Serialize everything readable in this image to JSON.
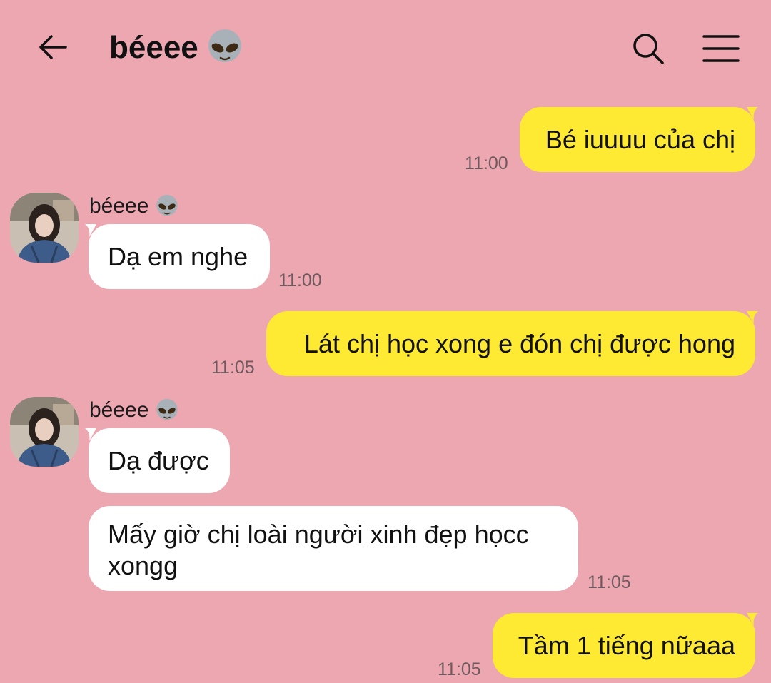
{
  "header": {
    "title": "béeee",
    "title_emoji": "alien-face-icon",
    "back_icon": "back-arrow-icon",
    "search_icon": "search-icon",
    "menu_icon": "menu-icon"
  },
  "colors": {
    "background": "#eda7b1",
    "outgoing_bubble": "#fee933",
    "incoming_bubble": "#ffffff"
  },
  "messages": [
    {
      "direction": "outgoing",
      "text": "Bé iuuuu của chị",
      "time": "11:00"
    },
    {
      "direction": "incoming",
      "sender": "béeee",
      "text": "Dạ em nghe",
      "time": "11:00"
    },
    {
      "direction": "outgoing",
      "text": "Lát chị học xong e đón chị được hong",
      "time": "11:05"
    },
    {
      "direction": "incoming",
      "sender": "béeee",
      "text": "Dạ được",
      "time": ""
    },
    {
      "direction": "incoming",
      "text": "Mấy giờ chị loài người xinh đẹp họcc xongg",
      "time": "11:05"
    },
    {
      "direction": "outgoing",
      "text": "Tầm 1 tiếng nữaaa",
      "time": "11:05"
    }
  ]
}
